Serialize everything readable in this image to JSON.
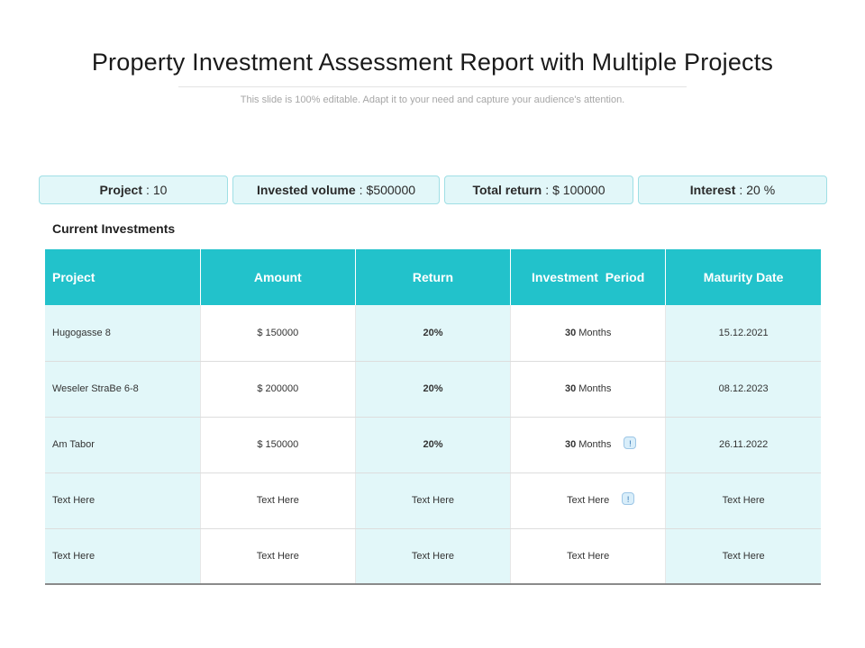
{
  "header": {
    "title": "Property Investment Assessment Report with Multiple Projects",
    "subtitle": "This slide is 100% editable. Adapt it to your need and capture your audience's attention."
  },
  "summary": [
    {
      "label": "Project",
      "separator": ":",
      "value": "10"
    },
    {
      "label": "Invested volume",
      "separator": ":",
      "value": "$500000"
    },
    {
      "label": "Total return",
      "separator": ":",
      "value": "$ 100000"
    },
    {
      "label": "Interest",
      "separator": ":",
      "value": "20 %"
    }
  ],
  "section_label": "Current Investments",
  "table": {
    "columns": [
      "Project",
      "Amount",
      "Return",
      "Investment  Period",
      "Maturity Date"
    ],
    "rows": [
      {
        "project": "Hugogasse 8",
        "amount": "$ 150000",
        "return": "20%",
        "period_num": "30",
        "period_unit": "Months",
        "maturity": "15.12.2021"
      },
      {
        "project": "Weseler StraBe 6-8",
        "amount": "$ 200000",
        "return": "20%",
        "period_num": "30",
        "period_unit": "Months",
        "maturity": "08.12.2023"
      },
      {
        "project": "Am Tabor",
        "amount": "$ 150000",
        "return": "20%",
        "period_num": "30",
        "period_unit": "Months",
        "maturity": "26.11.2022",
        "badge": "!"
      },
      {
        "project": "Text Here",
        "amount": "Text Here",
        "return": "Text Here",
        "period_text": "Text Here",
        "maturity": "Text Here",
        "badge": "!"
      },
      {
        "project": "Text Here",
        "amount": "Text Here",
        "return": "Text Here",
        "period_text": "Text Here",
        "maturity": "Text Here"
      }
    ]
  },
  "colors": {
    "header_fill": "#22c2cb",
    "tint_fill": "#e2f7f9",
    "box_border": "#9fdfe5"
  }
}
